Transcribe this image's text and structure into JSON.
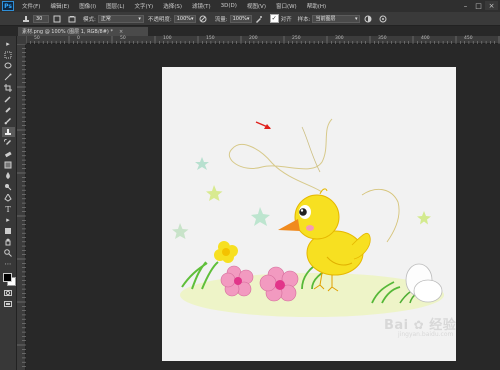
{
  "app": {
    "logo": "Ps"
  },
  "menu": [
    "文件(F)",
    "编辑(E)",
    "图像(I)",
    "图层(L)",
    "文字(Y)",
    "选择(S)",
    "滤镜(T)",
    "3D(D)",
    "视图(V)",
    "窗口(W)",
    "帮助(H)"
  ],
  "window_controls": {
    "minimize": "–",
    "maximize": "□",
    "close": "×"
  },
  "options": {
    "brush_size": "30",
    "mode_label": "模式:",
    "mode_value": "正常",
    "opacity_label": "不透明度:",
    "opacity_value": "100%",
    "flow_label": "流量:",
    "flow_value": "100%",
    "align_label": "对齐",
    "sample_label": "样本:",
    "sample_value": "当前图层"
  },
  "document_tab": {
    "title": "素材.png @ 100% (图层 1, RGB/8#) *",
    "close": "×"
  },
  "ruler": {
    "h_ticks": [
      "50",
      "0",
      "50",
      "100",
      "150",
      "200",
      "250",
      "300",
      "350",
      "400",
      "450",
      "500"
    ]
  },
  "watermark": {
    "brand": "Bai",
    "brand2": "经验",
    "sub": "jingyan.baidu.com"
  },
  "colors": {
    "accent": "#31a8ff",
    "canvas": "#f2f2f2",
    "workspace": "#282828",
    "duck": "#f7e021",
    "beak": "#f08a1e",
    "flower": "#f29ac0"
  }
}
